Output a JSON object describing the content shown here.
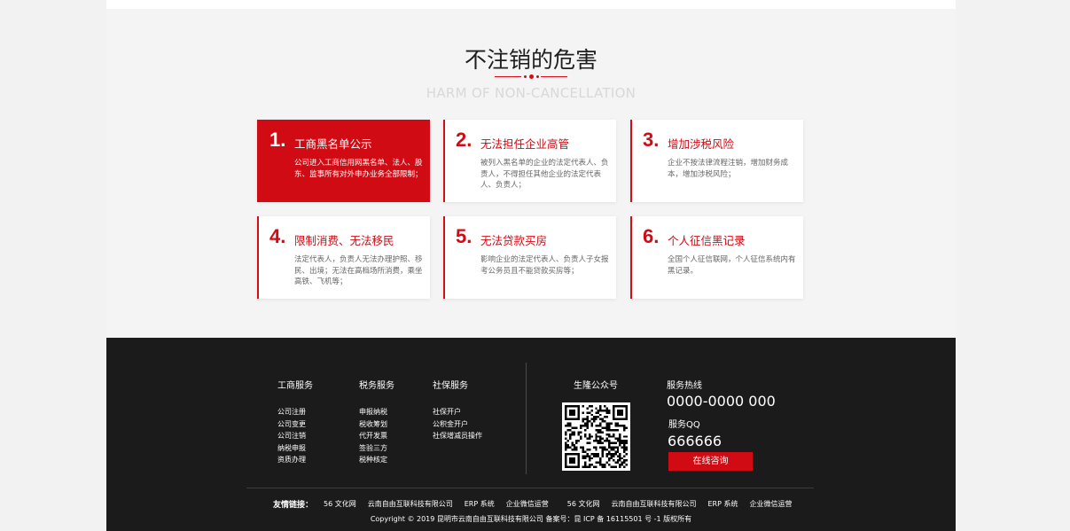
{
  "section": {
    "title": "不注销的危害",
    "subtitle": "HARM OF NON-CANCELLATION",
    "cards": [
      {
        "num": "1.",
        "title": "工商黑名单公示",
        "desc": "公司进入工商信用网黑名单、法人、股东、监事所有对外申办业务全部限制；"
      },
      {
        "num": "2.",
        "title": "无法担任企业高管",
        "desc": "被列入黑名单的企业的法定代表人、负责人，不得担任其他企业的法定代表人、负责人；"
      },
      {
        "num": "3.",
        "title": "增加涉税风险",
        "desc": "企业不按法律流程注销，增加财务成本，增加涉税风险；"
      },
      {
        "num": "4.",
        "title": "限制消费、无法移民",
        "desc": "法定代表人，负责人无法办理护照、移民、出境；无法在高档场所消费，乘坐高铁、飞机等；"
      },
      {
        "num": "5.",
        "title": "无法贷款买房",
        "desc": "影响企业的法定代表人、负责人子女报考公务员且不能贷款买房等；"
      },
      {
        "num": "6.",
        "title": "个人征信黑记录",
        "desc": "全国个人征信联网，个人征信系统内有黑记录。"
      }
    ]
  },
  "footer": {
    "columns": [
      {
        "title": "工商服务",
        "items": [
          "公司注册",
          "公司变更",
          "公司注销",
          "纳税申报",
          "资质办理"
        ]
      },
      {
        "title": "税务服务",
        "items": [
          "申报纳税",
          "税收筹划",
          "代开发票",
          "签验三方",
          "税种核定"
        ]
      },
      {
        "title": "社保服务",
        "items": [
          "社保开户",
          "公积金开户",
          "社保增减员操作"
        ]
      }
    ],
    "qr_title": "生隆公众号",
    "hotline_label": "服务热线",
    "hotline": "0000-0000 000",
    "qq_label": "服务QQ",
    "qq": "666666",
    "consult_button": "在线咨询",
    "links_label": "友情链接：",
    "links": [
      "56 文化网",
      "云南自由互联科技有限公司",
      "ERP 系统",
      "企业微信运营",
      "56 文化网",
      "云南自由互联科技有限公司",
      "ERP 系统",
      "企业微信运营"
    ],
    "copyright": "Copyright © 2019 昆明市云南自由互联科技有限公司 备案号：昆 ICP 备 16115501 号 -1 版权所有"
  },
  "colors": {
    "accent": "#d10b14",
    "footer_bg": "#1b1b1b",
    "section_bg": "#f4f4f4"
  },
  "icons": {
    "qr": "qr-code-icon"
  }
}
